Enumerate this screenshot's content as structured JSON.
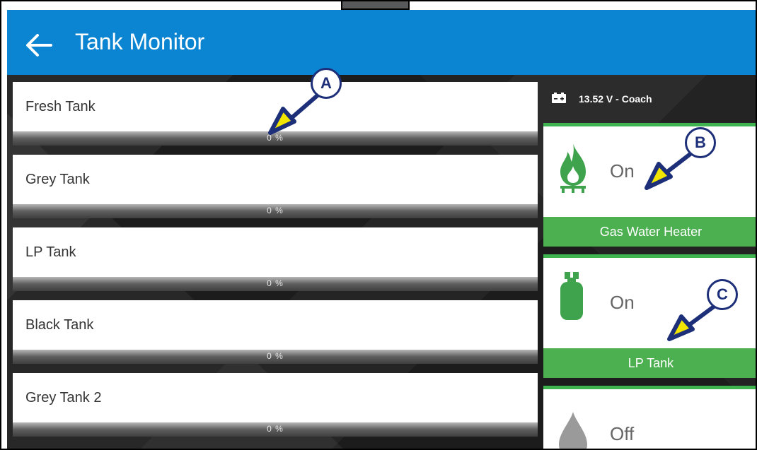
{
  "header": {
    "title": "Tank Monitor",
    "back_icon": "arrow-left-icon",
    "color": "#0b84d2"
  },
  "tanks": [
    {
      "name": "Fresh Tank",
      "level_percent": 0,
      "percent_label": "0 %"
    },
    {
      "name": "Grey Tank",
      "level_percent": 0,
      "percent_label": "0 %"
    },
    {
      "name": "LP Tank",
      "level_percent": 0,
      "percent_label": "0 %"
    },
    {
      "name": "Black Tank",
      "level_percent": 0,
      "percent_label": "0 %"
    },
    {
      "name": "Grey Tank 2",
      "level_percent": 0,
      "percent_label": "0 %"
    }
  ],
  "status": {
    "battery": "13.52 V - Coach",
    "icon": "battery-icon"
  },
  "tiles": [
    {
      "state": "On",
      "label": "Gas Water Heater",
      "icon": "flame-icon",
      "active": true
    },
    {
      "state": "On",
      "label": "LP Tank",
      "icon": "lp-cylinder-icon",
      "active": true
    },
    {
      "state": "Off",
      "icon": "water-drop-icon",
      "active": false
    }
  ],
  "callouts": [
    "A",
    "B",
    "C"
  ],
  "colors": {
    "accent_green": "#4caf50",
    "callout_navy": "#1c2f78",
    "arrow_yellow": "#f2e600"
  }
}
